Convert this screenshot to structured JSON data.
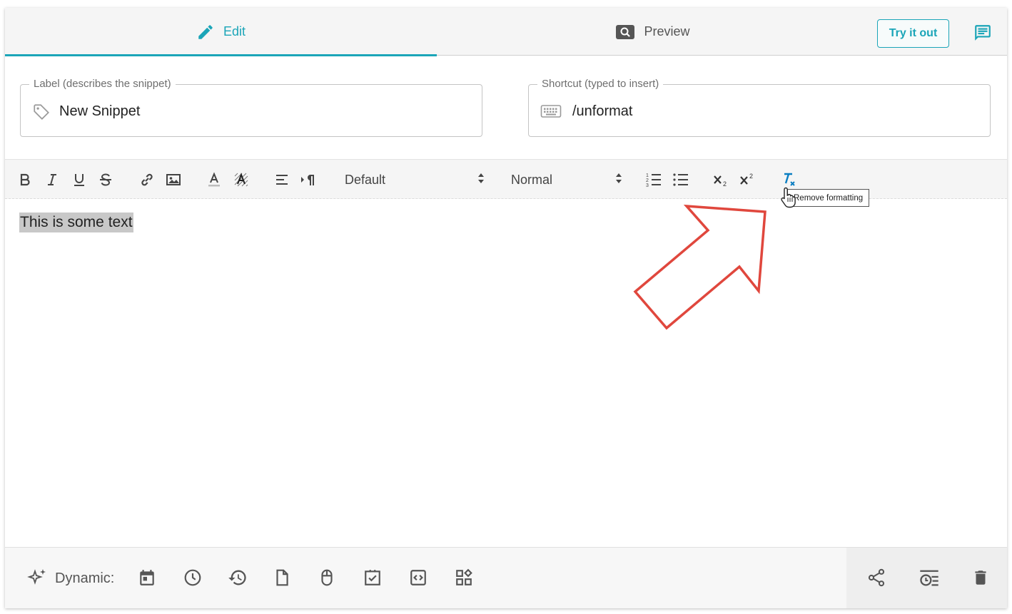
{
  "tabs": {
    "edit_label": "Edit",
    "preview_label": "Preview"
  },
  "header": {
    "try_label": "Try it out"
  },
  "fields": {
    "label_title": "Label (describes the snippet)",
    "label_value": "New Snippet",
    "shortcut_title": "Shortcut (typed to insert)",
    "shortcut_value": "/unformat"
  },
  "toolbar": {
    "font_select": "Default",
    "size_select": "Normal",
    "tooltip": "Remove formatting"
  },
  "editor": {
    "content": "This is some text"
  },
  "bottom": {
    "dynamic_label": "Dynamic:"
  },
  "colors": {
    "accent": "#1ba5b8",
    "annotation_arrow": "#e0473d",
    "clean_icon": "#0a7ec2"
  }
}
